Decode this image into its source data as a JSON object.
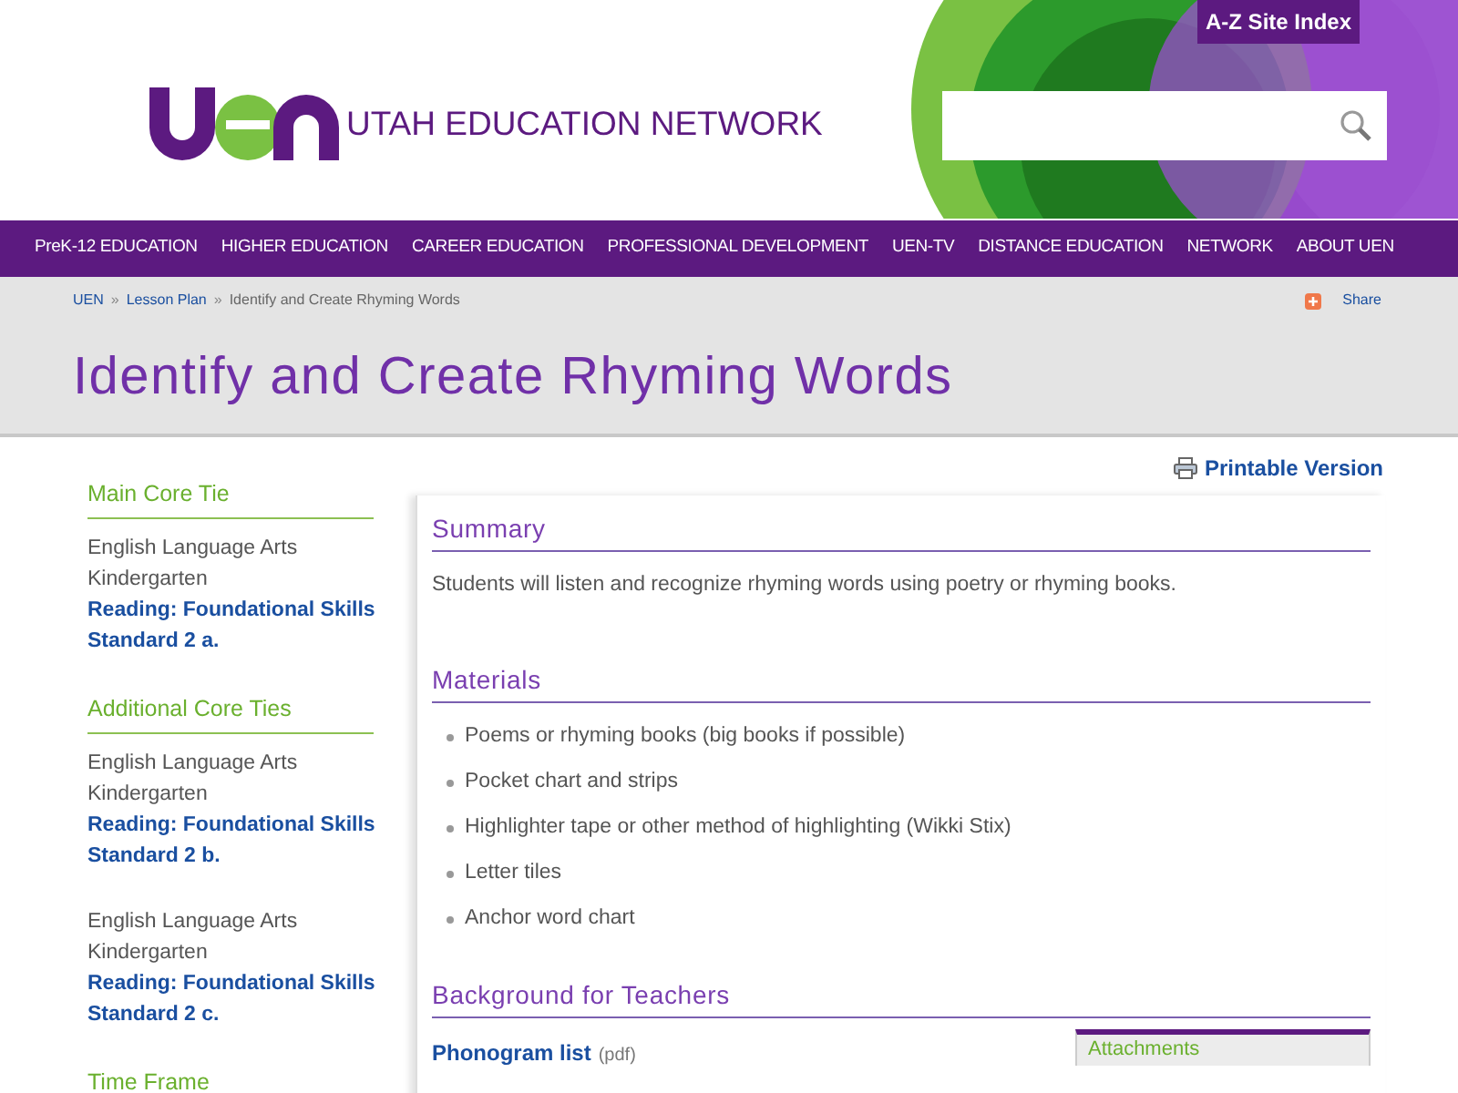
{
  "header": {
    "logo_text": "UTAH EDUCATION NETWORK",
    "site_index": "A-Z Site Index"
  },
  "nav": [
    "PreK-12 EDUCATION",
    "HIGHER EDUCATION",
    "CAREER EDUCATION",
    "PROFESSIONAL DEVELOPMENT",
    "UEN-TV",
    "DISTANCE EDUCATION",
    "NETWORK",
    "ABOUT UEN"
  ],
  "breadcrumb": [
    {
      "label": "UEN",
      "kind": "link"
    },
    {
      "label": "»",
      "kind": "separator"
    },
    {
      "label": "Lesson Plan",
      "kind": "link"
    },
    {
      "label": "»",
      "kind": "separator"
    },
    {
      "label": "Identify and Create Rhyming Words",
      "kind": "current"
    }
  ],
  "share": "Share",
  "page_title": "Identify and Create Rhyming Words",
  "sidebar": [
    {
      "heading": "Main Core Tie",
      "ties": [
        {
          "subject": "English Language Arts",
          "grade": "Kindergarten",
          "link1": "Reading: Foundational Skills",
          "link2": "Standard 2 a."
        }
      ]
    },
    {
      "heading": "Additional Core Ties",
      "ties": [
        {
          "subject": "English Language Arts",
          "grade": "Kindergarten",
          "link1": "Reading: Foundational Skills",
          "link2": "Standard 2 b."
        },
        {
          "subject": "English Language Arts",
          "grade": "Kindergarten",
          "link1": "Reading: Foundational Skills",
          "link2": "Standard 2 c."
        }
      ]
    },
    {
      "heading": "Time Frame"
    }
  ],
  "printable": "Printable Version",
  "summary": {
    "heading": "Summary",
    "text": "Students will listen and recognize rhyming words using poetry or rhyming books."
  },
  "materials": {
    "heading": "Materials",
    "items": [
      "Poems or rhyming books (big books if possible)",
      "Pocket chart and strips",
      "Highlighter tape or other method of highlighting (Wikki Stix)",
      "Letter tiles",
      "Anchor word chart"
    ]
  },
  "background": {
    "heading": "Background for Teachers",
    "link": "Phonogram list",
    "note": "(pdf)"
  },
  "attachments": {
    "heading": "Attachments"
  }
}
